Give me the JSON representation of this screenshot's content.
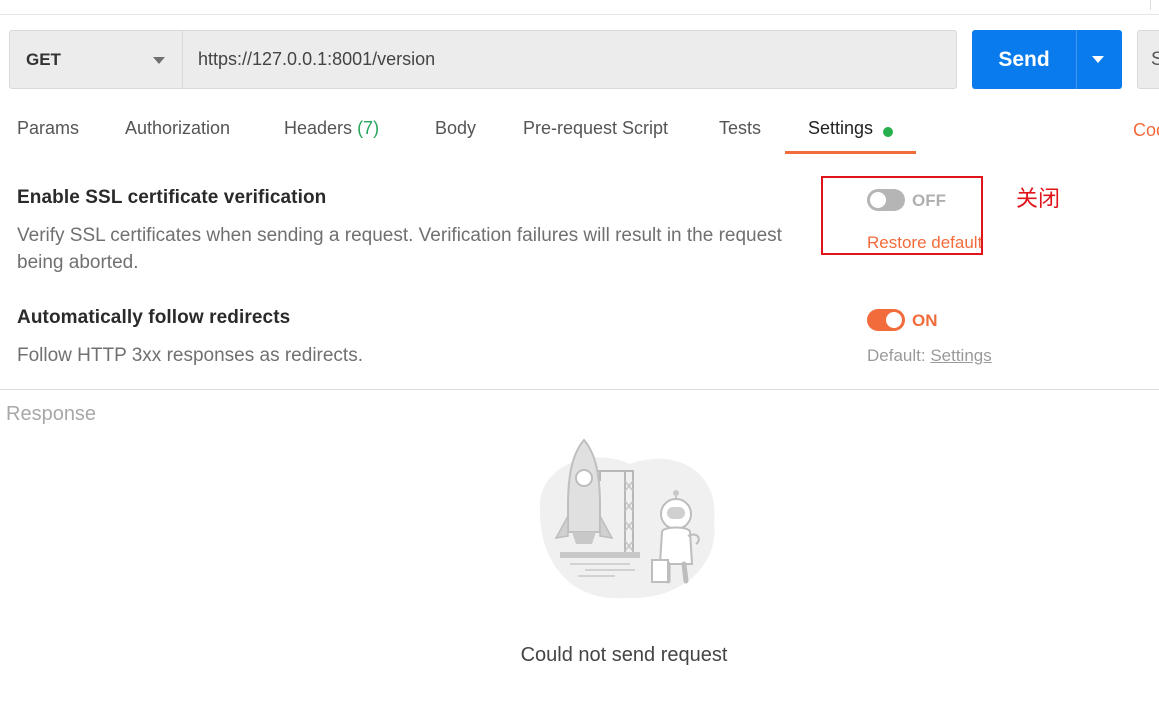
{
  "request": {
    "method": "GET",
    "url": "https://127.0.0.1:8001/version",
    "send_label": "Send",
    "save_label": "S"
  },
  "tabs": [
    {
      "label": "Params"
    },
    {
      "label": "Authorization"
    },
    {
      "label": "Headers",
      "count": "(7)"
    },
    {
      "label": "Body"
    },
    {
      "label": "Pre-request Script"
    },
    {
      "label": "Tests"
    },
    {
      "label": "Settings",
      "active": true
    }
  ],
  "cookies_label": "Coo",
  "settings": {
    "ssl": {
      "title": "Enable SSL certificate verification",
      "description": "Verify SSL certificates when sending a request. Verification failures will result in the request being aborted.",
      "state_label": "OFF",
      "enabled": false,
      "restore_label": "Restore default"
    },
    "redirects": {
      "title": "Automatically follow redirects",
      "description": "Follow HTTP 3xx responses as redirects.",
      "state_label": "ON",
      "enabled": true,
      "default_prefix": "Default: ",
      "default_link": "Settings"
    }
  },
  "annotation": {
    "text": "关闭",
    "color": "#e0141b"
  },
  "response": {
    "label": "Response",
    "empty_message": "Could not send request"
  },
  "colors": {
    "accent": "#f26b3a",
    "primary": "#097bed",
    "success": "#26b14e"
  },
  "icons": {
    "illustration": "rocket-astronaut-illustration"
  }
}
